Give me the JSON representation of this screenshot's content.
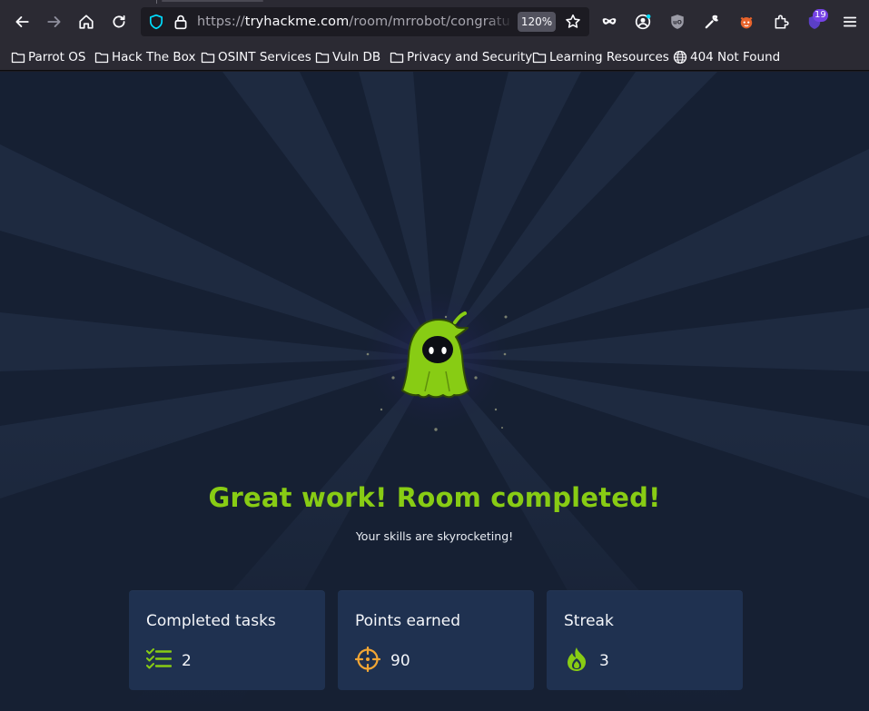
{
  "browser": {
    "url_scheme": "https://",
    "url_host": "tryhackme.com",
    "url_path": "/room/mrrobot/congratulations",
    "zoom": "120%",
    "extension_badge": "19"
  },
  "bookmarks": [
    {
      "label": "Parrot OS",
      "icon": "folder-icon"
    },
    {
      "label": "Hack The Box",
      "icon": "folder-icon"
    },
    {
      "label": "OSINT Services",
      "icon": "folder-icon"
    },
    {
      "label": "Vuln DB",
      "icon": "folder-icon"
    },
    {
      "label": "Privacy and Security",
      "icon": "folder-icon"
    },
    {
      "label": "Learning Resources",
      "icon": "folder-icon"
    },
    {
      "label": "404 Not Found",
      "icon": "globe-icon"
    }
  ],
  "main": {
    "headline": "Great work! Room completed!",
    "subline": "Your skills are skyrocketing!",
    "cards": [
      {
        "title": "Completed tasks",
        "value": "2",
        "icon": "task-list-icon"
      },
      {
        "title": "Points earned",
        "value": "90",
        "icon": "crosshair-icon"
      },
      {
        "title": "Streak",
        "value": "3",
        "icon": "flame-icon"
      }
    ]
  },
  "colors": {
    "accent": "#88cc14",
    "page_bg": "#162033",
    "card_bg": "#1f3150",
    "toolbar_bg": "#2b2a33"
  }
}
